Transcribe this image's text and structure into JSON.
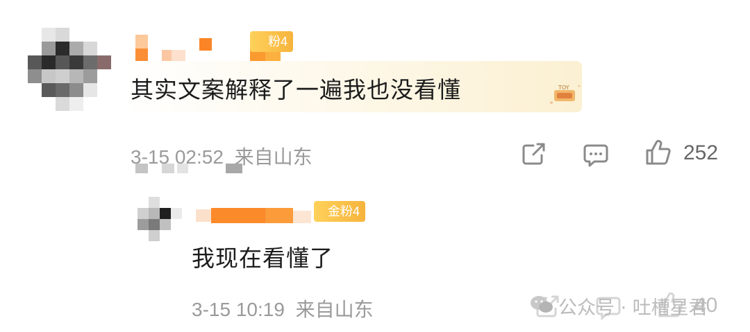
{
  "colors": {
    "badge": "#f6b43d",
    "meta_text": "#9a9a9a",
    "icon": "#8a8a8a",
    "bubble": "#fbf0d2",
    "username_orange": "#fb8c26"
  },
  "main_comment": {
    "username": "",
    "badge_label": "粉4",
    "text": "其实文案解释了一遍我也没看懂",
    "time": "3-15 02:52",
    "location": "来自山东",
    "actions": {
      "share_icon": "share-icon",
      "reply_icon": "comment-icon",
      "like_icon": "thumbs-up-icon"
    },
    "like_count": "252"
  },
  "reply_comment": {
    "username": "",
    "badge_label": "金粉4",
    "text": "我现在看懂了",
    "time": "3-15 10:19",
    "location": "来自山东",
    "like_count": "40"
  },
  "watermark": {
    "text": "公众号 · 吐槽星君",
    "logo_icon": "wechat-official-account-icon"
  }
}
